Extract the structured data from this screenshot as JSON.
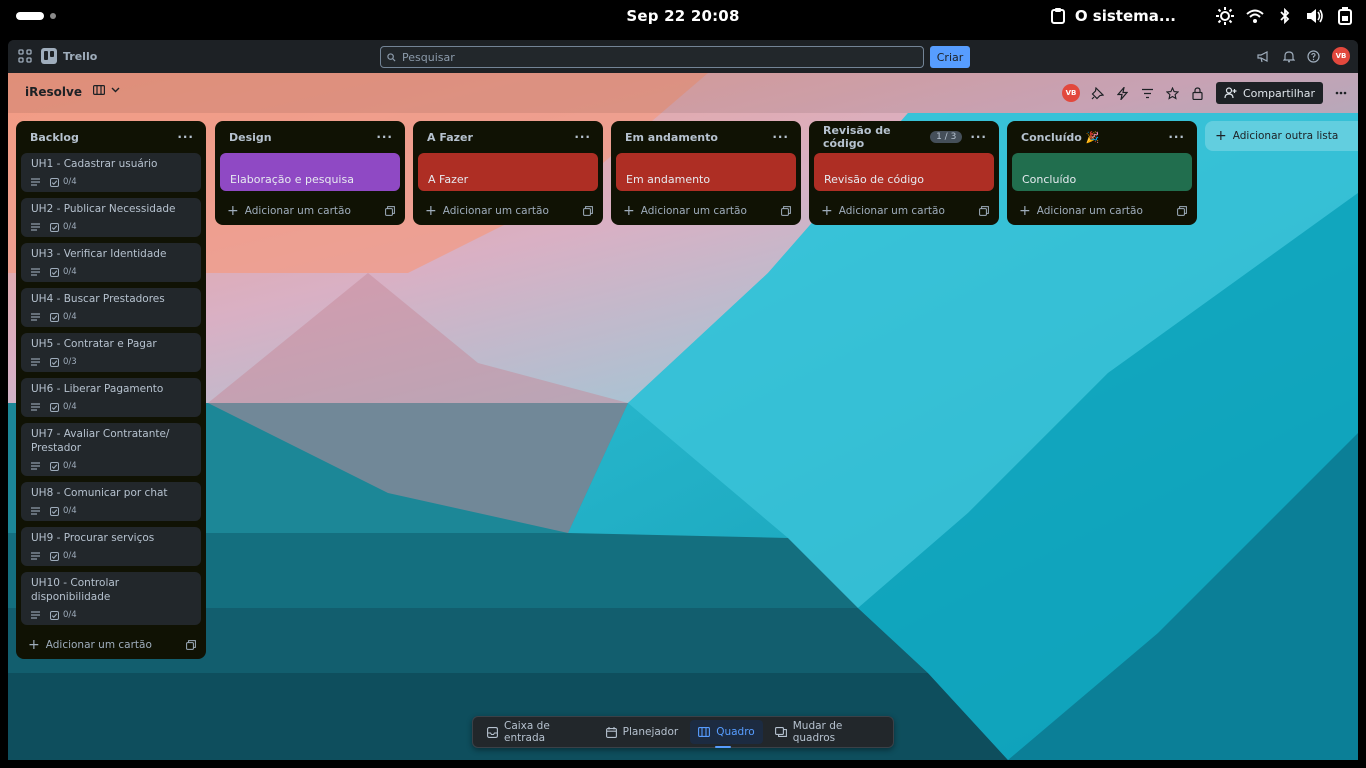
{
  "os": {
    "clock": "Sep 22  20:08",
    "notification": "O sistema..."
  },
  "app": {
    "name": "Trello",
    "search_placeholder": "Pesquisar",
    "create_label": "Criar",
    "user_initials": "VB"
  },
  "board": {
    "title": "iResolve",
    "share_label": "Compartilhar",
    "add_list_label": "Adicionar outra lista"
  },
  "lists": [
    {
      "title": "Backlog",
      "add_card_label": "Adicionar um cartão",
      "cards": [
        {
          "title": "UH1 - Cadastrar usuário",
          "checklist": "0/4"
        },
        {
          "title": "UH2 - Publicar Necessidade",
          "checklist": "0/4"
        },
        {
          "title": "UH3 - Verificar Identidade",
          "checklist": "0/4"
        },
        {
          "title": "UH4 - Buscar Prestadores",
          "checklist": "0/4"
        },
        {
          "title": "UH5 - Contratar e Pagar",
          "checklist": "0/3"
        },
        {
          "title": "UH6 - Liberar Pagamento",
          "checklist": "0/4"
        },
        {
          "title": "UH7 - Avaliar Contratante/ Prestador",
          "checklist": "0/4"
        },
        {
          "title": "UH8 - Comunicar por chat",
          "checklist": "0/4"
        },
        {
          "title": "UH9 - Procurar serviços",
          "checklist": "0/4"
        },
        {
          "title": "UH10 - Controlar disponibilidade",
          "checklist": "0/4"
        }
      ]
    },
    {
      "title": "Design",
      "cover_card": "Elaboração e pesquisa",
      "cover_color": "#8f49c4",
      "add_card_label": "Adicionar um cartão"
    },
    {
      "title": "A Fazer",
      "cover_card": "A Fazer",
      "cover_color": "#ae2e24",
      "add_card_label": "Adicionar um cartão"
    },
    {
      "title": "Em andamento",
      "cover_card": "Em andamento",
      "cover_color": "#ae2e24",
      "add_card_label": "Adicionar um cartão"
    },
    {
      "title": "Revisão de código",
      "count": "1 / 3",
      "cover_card": "Revisão de código",
      "cover_color": "#ae2e24",
      "add_card_label": "Adicionar um cartão"
    },
    {
      "title": "Concluído 🎉",
      "cover_card": "Concluído",
      "cover_color": "#216e4e",
      "add_card_label": "Adicionar um cartão"
    }
  ],
  "dock": {
    "inbox": "Caixa de entrada",
    "planner": "Planejador",
    "board": "Quadro",
    "switch": "Mudar de quadros"
  }
}
